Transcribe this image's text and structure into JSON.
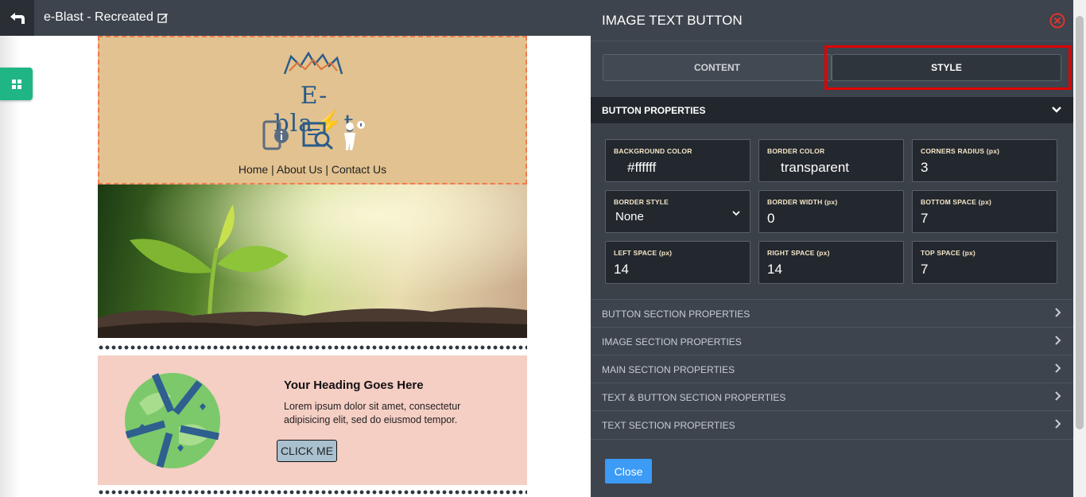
{
  "topbar": {
    "back_icon": "undo-arrow-icon",
    "title": "e-Blast - Recreated",
    "edit_icon": "edit-icon"
  },
  "sidebar": {
    "blocks_icon": "grid-icon"
  },
  "email": {
    "logo_text": "E-bla⚡t",
    "nav": {
      "home": "Home",
      "sep1": " | ",
      "about": "About Us",
      "sep2": " | ",
      "contact": "Contact Us"
    },
    "feature": {
      "heading": "Your Heading Goes Here",
      "body": "Lorem ipsum dolor sit amet, consectetur adipisicing elit, sed do eiusmod tempor.",
      "button": "CLICK ME"
    }
  },
  "panel": {
    "title": "IMAGE TEXT BUTTON",
    "close_icon": "close-circle-icon",
    "tabs": {
      "content": "CONTENT",
      "style": "STYLE"
    },
    "open_section": "BUTTON PROPERTIES",
    "props": {
      "bg_color": {
        "label": "BACKGROUND COLOR",
        "value": "#ffffff"
      },
      "border_color": {
        "label": "BORDER COLOR",
        "value": "transparent"
      },
      "corners": {
        "label": "CORNERS RADIUS (px)",
        "value": "3"
      },
      "border_style": {
        "label": "BORDER STYLE",
        "value": "None"
      },
      "border_width": {
        "label": "BORDER WIDTH (px)",
        "value": "0"
      },
      "bottom_space": {
        "label": "BOTTOM SPACE (px)",
        "value": "7"
      },
      "left_space": {
        "label": "LEFT SPACE (px)",
        "value": "14"
      },
      "right_space": {
        "label": "RIGHT SPACE (px)",
        "value": "14"
      },
      "top_space": {
        "label": "TOP SPACE (px)",
        "value": "7"
      }
    },
    "sections": [
      "BUTTON SECTION PROPERTIES",
      "IMAGE SECTION PROPERTIES",
      "MAIN SECTION PROPERTIES",
      "TEXT & BUTTON SECTION PROPERTIES",
      "TEXT SECTION PROPERTIES"
    ],
    "close_button": "Close"
  },
  "colors": {
    "accent": "#3b9bf5",
    "highlight": "#e00000",
    "panel_bg": "#3d444d",
    "green": "#1fb585"
  }
}
